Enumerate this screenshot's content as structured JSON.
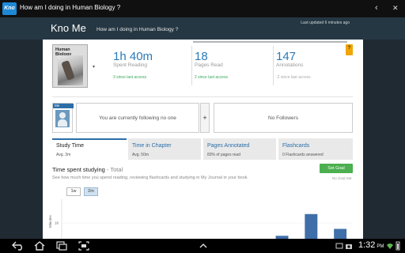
{
  "appbar": {
    "logo_text": "Kno",
    "title": "How am I doing in Human Biology ?",
    "back_icon": "‹",
    "close_icon": "✕"
  },
  "header": {
    "brand": "Kno Me",
    "subtitle": "How am I doing in Human Biology ?",
    "updated": "Last updated 6 minutes ago"
  },
  "alert_icon": "?",
  "book": {
    "title": "Human Biology",
    "caret": "▾"
  },
  "stats": [
    {
      "value": "1h 40m",
      "label": "Spent Reading",
      "delta": "3 since last access"
    },
    {
      "value": "18",
      "label": "Pages Read",
      "delta": "2 since last access"
    },
    {
      "value": "147",
      "label": "Annotations",
      "delta": "-2 since last access"
    }
  ],
  "social": {
    "me_label": "Me",
    "following": "You are currently following no one",
    "plus": "+",
    "followers": "No Followers"
  },
  "tabs": [
    {
      "title": "Study Time",
      "sub": "Avg. 3m"
    },
    {
      "title": "Time in Chapter",
      "sub": "Avg. 50m"
    },
    {
      "title": "Pages Annotated",
      "sub": "83% of pages read"
    },
    {
      "title": "Flashcards",
      "sub": "0 Flashcards answered"
    }
  ],
  "study": {
    "title": "Time spent studying",
    "total": " - Total",
    "description": "See how much time you spend reading, reviewing flashcards and studying in My Journal in your book.",
    "goal_button": "Set Goal",
    "no_goal": "No Goal Set",
    "ranges": [
      "1w",
      "2m"
    ],
    "active_range": "2m",
    "y_axis_label": "Minutes"
  },
  "chart_data": {
    "type": "bar",
    "ylabel": "Minutes",
    "y_tick_visible": "16",
    "bar_color": "#3f6fa8",
    "values": [
      0,
      0,
      0,
      0,
      0,
      0,
      0,
      0,
      0,
      0,
      0,
      0,
      0,
      0,
      0,
      0,
      0,
      0,
      0,
      0,
      0,
      0,
      0,
      0,
      0,
      0,
      0,
      0,
      0,
      0,
      0,
      0,
      0,
      0,
      3,
      0,
      0,
      0,
      0,
      0,
      25,
      0,
      0,
      0,
      0,
      0,
      10,
      0,
      0,
      0,
      2,
      0,
      0,
      0,
      0,
      0,
      0,
      0,
      0,
      0
    ],
    "ylim": [
      0,
      40
    ]
  },
  "sysbar": {
    "clock": "1:32",
    "ampm": "PM"
  }
}
